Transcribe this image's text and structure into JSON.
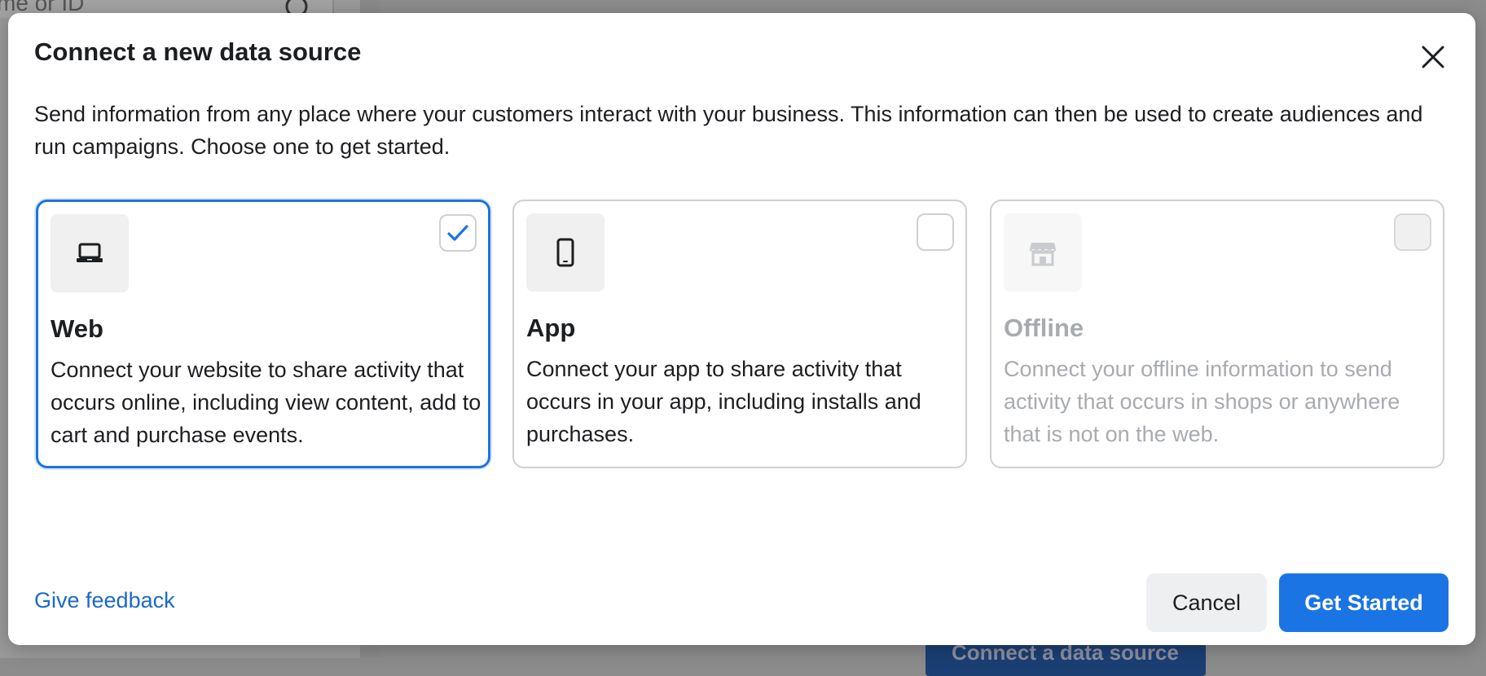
{
  "background": {
    "search_placeholder": "me or ID",
    "button_label": "Connect a data source"
  },
  "modal": {
    "title": "Connect a new data source",
    "description": "Send information from any place where your customers interact with your business. This information can then be used to create audiences and run campaigns. Choose one to get started.",
    "options": [
      {
        "title": "Web",
        "description": "Connect your website to share activity that occurs online, including view content, add to cart and purchase events.",
        "icon": "laptop-icon",
        "selected": true,
        "disabled": false
      },
      {
        "title": "App",
        "description": "Connect your app to share activity that occurs in your app, including installs and purchases.",
        "icon": "mobile-phone-icon",
        "selected": false,
        "disabled": false
      },
      {
        "title": "Offline",
        "description": "Connect your offline information to send activity that occurs in shops or anywhere that is not on the web.",
        "icon": "store-icon",
        "selected": false,
        "disabled": true
      }
    ],
    "feedback_link": "Give feedback",
    "cancel_label": "Cancel",
    "primary_label": "Get Started"
  },
  "colors": {
    "accent": "#1b74e4",
    "link": "#1b6ac9",
    "text": "#1c1e21",
    "disabled_text": "#a8abaf"
  }
}
